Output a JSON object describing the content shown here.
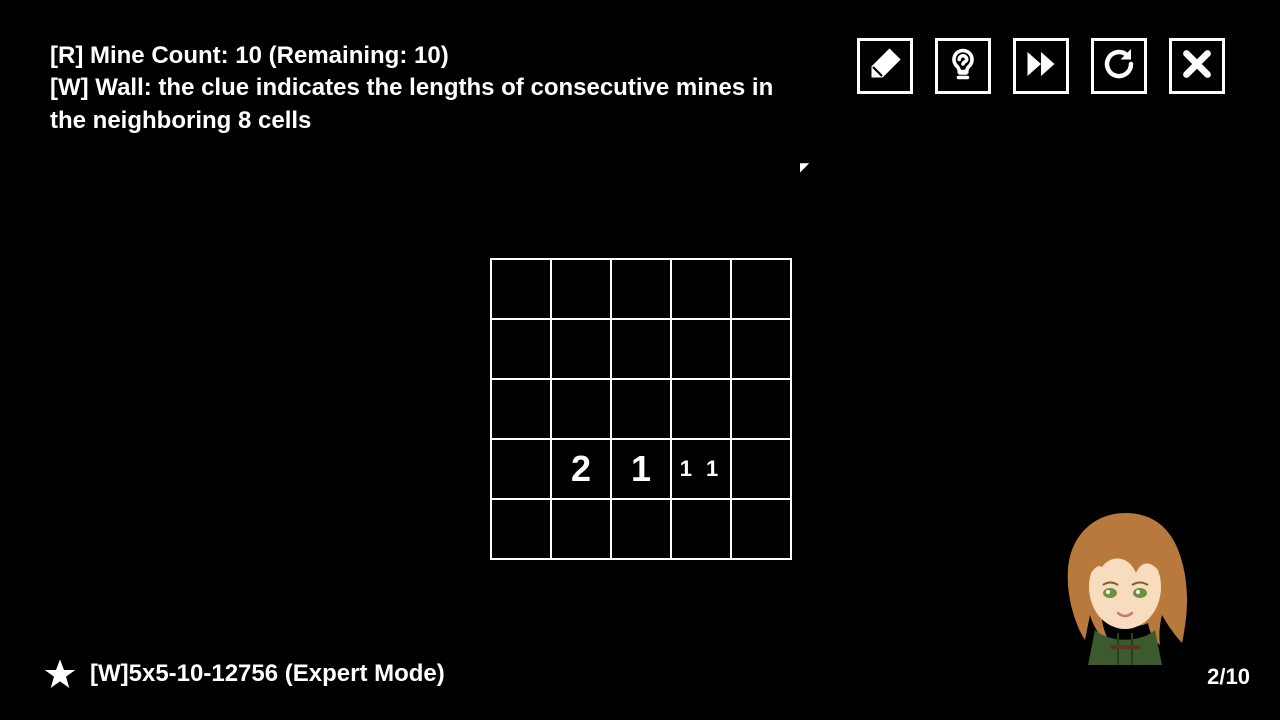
{
  "header": {
    "line1_prefix": "[R] Mine Count:  ",
    "mine_total": "10",
    "line1_remaining_prefix": " (Remaining: ",
    "mine_remaining": "10",
    "line1_suffix": ")",
    "line2": "[W] Wall: the clue indicates the lengths of consecutive mines in the neighboring 8 cells"
  },
  "toolbar": {
    "icons": [
      "brush-icon",
      "hint-icon",
      "fast-forward-icon",
      "restart-icon",
      "close-icon"
    ]
  },
  "grid": {
    "rows": 5,
    "cols": 5,
    "cells": [
      [
        "",
        "",
        "",
        "",
        ""
      ],
      [
        "",
        "",
        "",
        "",
        ""
      ],
      [
        "",
        "",
        "",
        "",
        ""
      ],
      [
        "",
        "2",
        "1",
        "1 1",
        ""
      ],
      [
        "",
        "",
        "",
        "",
        ""
      ]
    ],
    "cell_styles": [
      [
        "",
        "",
        "",
        "",
        ""
      ],
      [
        "",
        "",
        "",
        "",
        ""
      ],
      [
        "",
        "",
        "",
        "",
        ""
      ],
      [
        "",
        "big",
        "big",
        "small",
        ""
      ],
      [
        "",
        "",
        "",
        "",
        ""
      ]
    ]
  },
  "footer": {
    "level_label": "[W]5x5-10-12756 (Expert Mode)",
    "progress": "2/10"
  }
}
